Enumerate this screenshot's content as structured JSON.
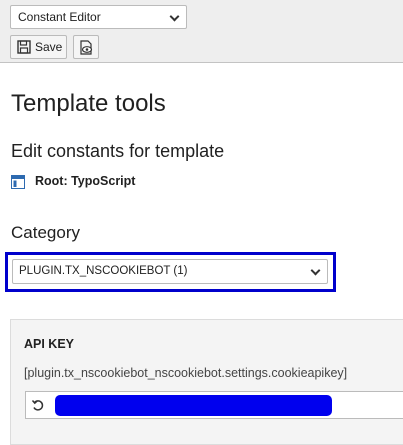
{
  "toolbar": {
    "mode_select_value": "Constant Editor",
    "save_label": "Save"
  },
  "page": {
    "title": "Template tools",
    "subtitle": "Edit constants for template",
    "root_label": "Root: TypoScript"
  },
  "category": {
    "label": "Category",
    "selected": "PLUGIN.TX_NSCOOKIEBOT (1)"
  },
  "constant": {
    "label": "API KEY",
    "path": "[plugin.tx_nscookiebot_nscookiebot.settings.cookieapikey]",
    "value": ""
  },
  "colors": {
    "highlight": "#0000cc",
    "redaction": "#0000ee"
  },
  "icons": {
    "save": "floppy-disk-icon",
    "view": "page-eye-icon",
    "root": "template-icon",
    "reset": "undo-icon",
    "chevron": "chevron-down-icon"
  }
}
